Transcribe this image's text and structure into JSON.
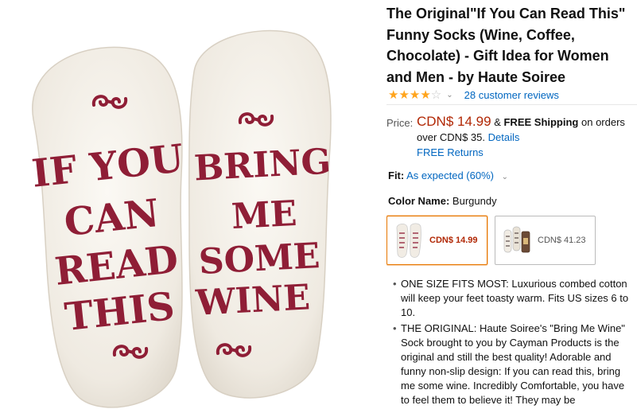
{
  "product": {
    "title": "The Original\"If You Can Read This\" Funny Socks (Wine, Coffee, Chocolate) - Gift Idea for Women and Men - by Haute Soiree",
    "rating_out_of_5": 4,
    "reviews_link": "28 customer reviews",
    "colors": {
      "sock": "#f3efe8",
      "print": "#8f1e36",
      "star": "#ffa41c",
      "link": "#0066c0",
      "price": "#b12704"
    },
    "image_left_text": [
      "IF YOU",
      "CAN",
      "READ",
      "THIS"
    ],
    "image_right_text": [
      "BRING",
      "ME",
      "SOME",
      "WINE"
    ]
  },
  "price": {
    "label": "Price:",
    "value": "CDN$ 14.99",
    "amp": "&",
    "free_shipping": "FREE Shipping",
    "on_orders": "on orders over CDN$ 35.",
    "details_link": "Details",
    "free_returns": "FREE Returns"
  },
  "fit": {
    "label": "Fit:",
    "value": "As expected (60%)"
  },
  "color": {
    "label": "Color Name:",
    "selected": "Burgundy",
    "swatches": [
      {
        "price": "CDN$ 14.99",
        "icon": "burgundy-socks-thumbnail"
      },
      {
        "price": "CDN$ 41.23",
        "icon": "socks-set-thumbnail"
      }
    ]
  },
  "bullets": [
    "ONE SIZE FITS MOST: Luxurious combed cotton will keep your feet toasty warm. Fits US sizes 6 to 10.",
    "THE ORIGINAL: Haute Soiree's \"Bring Me Wine\" Sock brought to you by Cayman Products is the original and still the best quality! Adorable and funny non-slip design: If you can read this, bring me some wine. Incredibly Comfortable, you have to feel them to believe it! They may be"
  ]
}
